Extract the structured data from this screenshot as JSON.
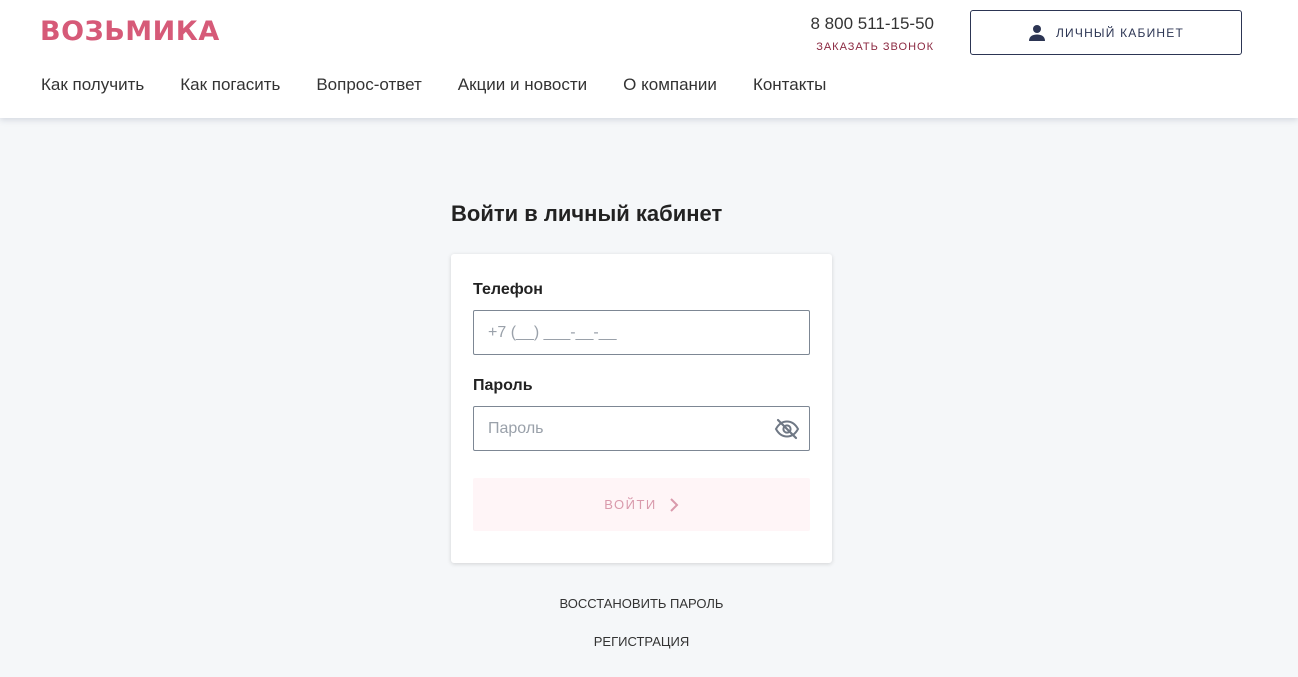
{
  "header": {
    "logo_text": "ВОЗЬМИКА",
    "phone": "8 800 511-15-50",
    "callback_label": "ЗАКАЗАТЬ ЗВОНОК",
    "cabinet_button_label": "ЛИЧНЫЙ КАБИНЕТ",
    "cabinet_icon": "user-icon"
  },
  "nav": {
    "items": [
      {
        "label": "Как получить"
      },
      {
        "label": "Как погасить"
      },
      {
        "label": "Вопрос-ответ"
      },
      {
        "label": "Акции и новости"
      },
      {
        "label": "О компании"
      },
      {
        "label": "Контакты"
      }
    ]
  },
  "login": {
    "title": "Войти в личный кабинет",
    "phone_label": "Телефон",
    "phone_placeholder": "+7 (__) ___-__-__",
    "phone_value": "",
    "password_label": "Пароль",
    "password_placeholder": "Пароль",
    "password_value": "",
    "password_toggle_icon": "eye-off-icon",
    "submit_label": "ВОЙТИ",
    "submit_icon": "chevron-right-icon",
    "restore_link": "ВОССТАНОВИТЬ ПАРОЛЬ",
    "register_link": "РЕГИСТРАЦИЯ"
  },
  "colors": {
    "brand": "#d65a78",
    "accent_dark": "#2c3553",
    "callback": "#8c2a42",
    "background": "#f5f7f9",
    "submit_disabled_bg": "#fff5f7",
    "submit_disabled_text": "#d99aac"
  }
}
